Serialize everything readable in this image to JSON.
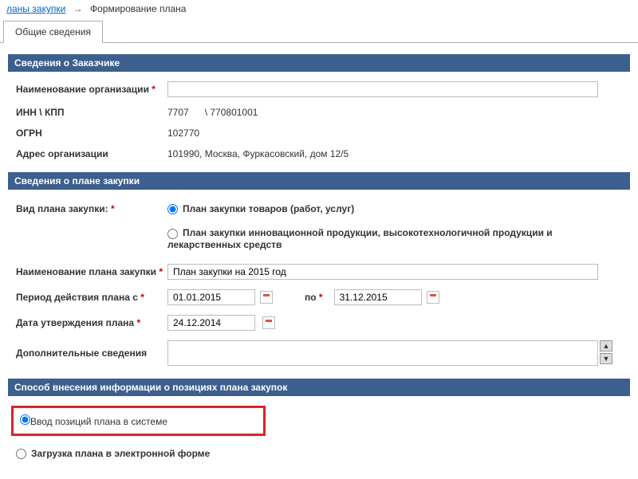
{
  "breadcrumb": {
    "link": "ланы закупки",
    "current": "Формирование плана"
  },
  "tabs": {
    "general": "Общие сведения"
  },
  "customer": {
    "header": "Сведения о Заказчике",
    "org_name_label": "Наименование организации",
    "org_name_value": "",
    "inn_kpp_label": "ИНН \\ КПП",
    "inn_value": "7707",
    "kpp_value": "\\ 770801001",
    "ogrn_label": "ОГРН",
    "ogrn_value": "102770",
    "address_label": "Адрес организации",
    "address_value": "101990, Москва, Фуркасовский, дом 12/5"
  },
  "plan": {
    "header": "Сведения о плане закупки",
    "type_label": "Вид плана закупки:",
    "type_opt1": "План закупки товаров (работ, услуг)",
    "type_opt2": "План закупки инновационной продукции, высокотехнологичной продукции и лекарственных средств",
    "name_label": "Наименование плана закупки",
    "name_value": "План закупки на 2015 год",
    "period_label": "Период действия плана с",
    "period_from": "01.01.2015",
    "period_to_label": "по",
    "period_to": "31.12.2015",
    "approve_date_label": "Дата утверждения плана",
    "approve_date": "24.12.2014",
    "extra_label": "Дополнительные сведения",
    "extra_value": ""
  },
  "entry": {
    "header": "Способ внесения информации о позициях плана закупок",
    "opt1": "Ввод позиций плана в системе",
    "opt2": "Загрузка плана в электронной форме"
  }
}
